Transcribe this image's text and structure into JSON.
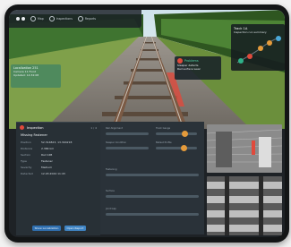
{
  "nav": {
    "items": [
      {
        "label": "Map",
        "icon": "map-icon"
      },
      {
        "label": "Inspections",
        "icon": "camera-icon"
      },
      {
        "label": "Reports",
        "icon": "document-icon"
      }
    ]
  },
  "overlay_left": {
    "title": "Localization 251",
    "line1": "Camera 11 Front",
    "line2": "Updated: 14:32:08"
  },
  "overlay_mid": {
    "title": "Problems",
    "line1": "Sleeper defects",
    "line2": "Rail surface wear"
  },
  "track_panel": {
    "title": "Track 1A",
    "subtitle": "Inspection run summary",
    "markers": [
      "1",
      "2",
      "3",
      "4",
      "5"
    ]
  },
  "left_panel": {
    "header": "Inspection",
    "page": "1 / 4",
    "title": "Missing Fastener",
    "rows": [
      {
        "k": "Position",
        "v": "52.314823, 13.394218"
      },
      {
        "k": "Distance",
        "v": "2.384 km"
      },
      {
        "k": "Section",
        "v": "Rail 14B"
      },
      {
        "k": "Type",
        "v": "Fastener"
      },
      {
        "k": "Severity",
        "v": "Medium"
      },
      {
        "k": "Detected",
        "v": "12.03.2024 11:43"
      }
    ],
    "button1": "Show Localization",
    "button2": "Open Report"
  },
  "mid_panel": {
    "sliders": [
      {
        "label": "Rail Alignment",
        "level": 0.0
      },
      {
        "label": "Track Gauge",
        "level": 0.7
      },
      {
        "label": "Sleeper Condition",
        "level": 0.0
      },
      {
        "label": "Ballast Profile",
        "level": 0.68
      },
      {
        "label": "Fastening",
        "level": 0.0
      },
      {
        "label": "Surface",
        "level": 0.0
      },
      {
        "label": "Joint Gap",
        "level": 0.0
      }
    ]
  },
  "colors": {
    "accent": "#e04a3c",
    "panel": "#283036",
    "button": "#2f6fb0",
    "knob": "#e59b3b"
  }
}
